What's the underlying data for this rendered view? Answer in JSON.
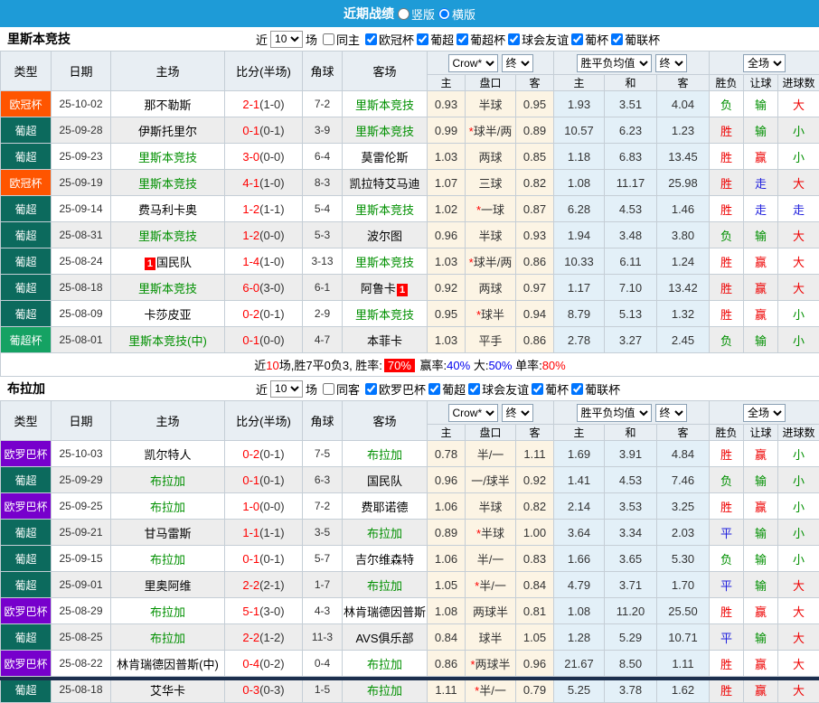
{
  "topbar": {
    "title": "近期战绩",
    "vertical": "竖版",
    "horizontal": "横版",
    "selected": "横版"
  },
  "header": {
    "cols": [
      "类型",
      "日期",
      "主场",
      "比分(半场)",
      "角球",
      "客场"
    ],
    "sub": [
      "主",
      "盘口",
      "客",
      "主",
      "和",
      "客",
      "胜负",
      "让球",
      "进球数"
    ],
    "odds_provider": "Crow*",
    "odds_state": "终",
    "avg_label": "胜平负均值",
    "avg_state": "终",
    "scope": "全场"
  },
  "colors": {
    "accent_blue": "#1e9bd7",
    "league_champions": "#ff5500",
    "league_liga_pt": "#0c6a5d",
    "league_supercup": "#15a263",
    "league_europa": "#7700cc",
    "win_red": "#ee0000",
    "lose_green": "#009000",
    "draw_blue": "#2020dd",
    "odds_bg": "#fcf4e4",
    "avg_bg": "#e3f0f8"
  },
  "tables": [
    {
      "team": "里斯本竞技",
      "filter": {
        "near_label": "近",
        "count": "10",
        "games_label": "场",
        "same_label": "同主",
        "same_checked": false,
        "leagues": [
          {
            "label": "欧冠杯",
            "checked": true
          },
          {
            "label": "葡超",
            "checked": true
          },
          {
            "label": "葡超杯",
            "checked": true
          },
          {
            "label": "球会友谊",
            "checked": true
          },
          {
            "label": "葡杯",
            "checked": true
          },
          {
            "label": "葡联杯",
            "checked": true
          }
        ]
      },
      "rows": [
        {
          "league": "欧冠杯",
          "league_color": "#ff5500",
          "date": "25-10-02",
          "home": "那不勒斯",
          "home_green": false,
          "score": "2-1",
          "half": "(1-0)",
          "corner": "7-2",
          "away": "里斯本竞技",
          "away_green": true,
          "odds": [
            "0.93",
            "半球",
            "0.95"
          ],
          "avg": [
            "1.93",
            "3.51",
            "4.04"
          ],
          "res": [
            [
              "负",
              "g"
            ],
            [
              "输",
              "g"
            ],
            [
              "大",
              "r"
            ]
          ]
        },
        {
          "league": "葡超",
          "league_color": "#0c6a5d",
          "date": "25-09-28",
          "home": "伊斯托里尔",
          "home_green": false,
          "score": "0-1",
          "half": "(0-1)",
          "corner": "3-9",
          "away": "里斯本竞技",
          "away_green": true,
          "odds": [
            "0.99",
            "*球半/两",
            "0.89"
          ],
          "avg": [
            "10.57",
            "6.23",
            "1.23"
          ],
          "res": [
            [
              "胜",
              "r"
            ],
            [
              "输",
              "g"
            ],
            [
              "小",
              "g"
            ]
          ]
        },
        {
          "league": "葡超",
          "league_color": "#0c6a5d",
          "date": "25-09-23",
          "home": "里斯本竞技",
          "home_green": true,
          "score": "3-0",
          "half": "(0-0)",
          "corner": "6-4",
          "away": "莫雷伦斯",
          "away_green": false,
          "odds": [
            "1.03",
            "两球",
            "0.85"
          ],
          "avg": [
            "1.18",
            "6.83",
            "13.45"
          ],
          "res": [
            [
              "胜",
              "r"
            ],
            [
              "赢",
              "r"
            ],
            [
              "小",
              "g"
            ]
          ]
        },
        {
          "league": "欧冠杯",
          "league_color": "#ff5500",
          "date": "25-09-19",
          "home": "里斯本竞技",
          "home_green": true,
          "score": "4-1",
          "half": "(1-0)",
          "corner": "8-3",
          "away": "凯拉特艾马迪",
          "away_green": false,
          "odds": [
            "1.07",
            "三球",
            "0.82"
          ],
          "avg": [
            "1.08",
            "11.17",
            "25.98"
          ],
          "res": [
            [
              "胜",
              "r"
            ],
            [
              "走",
              "b"
            ],
            [
              "大",
              "r"
            ]
          ]
        },
        {
          "league": "葡超",
          "league_color": "#0c6a5d",
          "date": "25-09-14",
          "home": "费马利卡奥",
          "home_green": false,
          "score": "1-2",
          "half": "(1-1)",
          "corner": "5-4",
          "away": "里斯本竞技",
          "away_green": true,
          "odds": [
            "1.02",
            "*一球",
            "0.87"
          ],
          "avg": [
            "6.28",
            "4.53",
            "1.46"
          ],
          "res": [
            [
              "胜",
              "r"
            ],
            [
              "走",
              "b"
            ],
            [
              "走",
              "b"
            ]
          ]
        },
        {
          "league": "葡超",
          "league_color": "#0c6a5d",
          "date": "25-08-31",
          "home": "里斯本竞技",
          "home_green": true,
          "score": "1-2",
          "half": "(0-0)",
          "corner": "5-3",
          "away": "波尔图",
          "away_green": false,
          "odds": [
            "0.96",
            "半球",
            "0.93"
          ],
          "avg": [
            "1.94",
            "3.48",
            "3.80"
          ],
          "res": [
            [
              "负",
              "g"
            ],
            [
              "输",
              "g"
            ],
            [
              "大",
              "r"
            ]
          ]
        },
        {
          "league": "葡超",
          "league_color": "#0c6a5d",
          "date": "25-08-24",
          "home": "国民队",
          "home_green": false,
          "home_rank": "1",
          "score": "1-4",
          "half": "(1-0)",
          "corner": "3-13",
          "away": "里斯本竞技",
          "away_green": true,
          "odds": [
            "1.03",
            "*球半/两",
            "0.86"
          ],
          "avg": [
            "10.33",
            "6.11",
            "1.24"
          ],
          "res": [
            [
              "胜",
              "r"
            ],
            [
              "赢",
              "r"
            ],
            [
              "大",
              "r"
            ]
          ]
        },
        {
          "league": "葡超",
          "league_color": "#0c6a5d",
          "date": "25-08-18",
          "home": "里斯本竞技",
          "home_green": true,
          "score": "6-0",
          "half": "(3-0)",
          "corner": "6-1",
          "away": "阿鲁卡",
          "away_green": false,
          "away_rank": "1",
          "odds": [
            "0.92",
            "两球",
            "0.97"
          ],
          "avg": [
            "1.17",
            "7.10",
            "13.42"
          ],
          "res": [
            [
              "胜",
              "r"
            ],
            [
              "赢",
              "r"
            ],
            [
              "大",
              "r"
            ]
          ]
        },
        {
          "league": "葡超",
          "league_color": "#0c6a5d",
          "date": "25-08-09",
          "home": "卡莎皮亚",
          "home_green": false,
          "score": "0-2",
          "half": "(0-1)",
          "corner": "2-9",
          "away": "里斯本竞技",
          "away_green": true,
          "odds": [
            "0.95",
            "*球半",
            "0.94"
          ],
          "avg": [
            "8.79",
            "5.13",
            "1.32"
          ],
          "res": [
            [
              "胜",
              "r"
            ],
            [
              "赢",
              "r"
            ],
            [
              "小",
              "g"
            ]
          ]
        },
        {
          "league": "葡超杯",
          "league_color": "#15a263",
          "date": "25-08-01",
          "home": "里斯本竞技(中)",
          "home_green": true,
          "score": "0-1",
          "half": "(0-0)",
          "corner": "4-7",
          "away": "本菲卡",
          "away_green": false,
          "odds": [
            "1.03",
            "平手",
            "0.86"
          ],
          "avg": [
            "2.78",
            "3.27",
            "2.45"
          ],
          "res": [
            [
              "负",
              "g"
            ],
            [
              "输",
              "g"
            ],
            [
              "小",
              "g"
            ]
          ]
        }
      ],
      "summary": [
        {
          "t": "近",
          "c": "k"
        },
        {
          "t": "10",
          "c": "r"
        },
        {
          "t": "场,胜7平0负3, 胜率:",
          "c": "k"
        },
        {
          "t": "70%",
          "c": "badge"
        },
        {
          "t": " 赢率:",
          "c": "k"
        },
        {
          "t": "40%",
          "c": "b"
        },
        {
          "t": " 大:",
          "c": "k"
        },
        {
          "t": "50%",
          "c": "b"
        },
        {
          "t": " 单率:",
          "c": "k"
        },
        {
          "t": "80%",
          "c": "r"
        }
      ]
    },
    {
      "team": "布拉加",
      "filter": {
        "near_label": "近",
        "count": "10",
        "games_label": "场",
        "same_label": "同客",
        "same_checked": false,
        "leagues": [
          {
            "label": "欧罗巴杯",
            "checked": true
          },
          {
            "label": "葡超",
            "checked": true
          },
          {
            "label": "球会友谊",
            "checked": true
          },
          {
            "label": "葡杯",
            "checked": true
          },
          {
            "label": "葡联杯",
            "checked": true
          }
        ]
      },
      "rows": [
        {
          "league": "欧罗巴杯",
          "league_color": "#7700cc",
          "date": "25-10-03",
          "home": "凯尔特人",
          "home_green": false,
          "score": "0-2",
          "half": "(0-1)",
          "corner": "7-5",
          "away": "布拉加",
          "away_green": true,
          "odds": [
            "0.78",
            "半/一",
            "1.11"
          ],
          "avg": [
            "1.69",
            "3.91",
            "4.84"
          ],
          "res": [
            [
              "胜",
              "r"
            ],
            [
              "赢",
              "r"
            ],
            [
              "小",
              "g"
            ]
          ]
        },
        {
          "league": "葡超",
          "league_color": "#0c6a5d",
          "date": "25-09-29",
          "home": "布拉加",
          "home_green": true,
          "score": "0-1",
          "half": "(0-1)",
          "corner": "6-3",
          "away": "国民队",
          "away_green": false,
          "odds": [
            "0.96",
            "一/球半",
            "0.92"
          ],
          "avg": [
            "1.41",
            "4.53",
            "7.46"
          ],
          "res": [
            [
              "负",
              "g"
            ],
            [
              "输",
              "g"
            ],
            [
              "小",
              "g"
            ]
          ]
        },
        {
          "league": "欧罗巴杯",
          "league_color": "#7700cc",
          "date": "25-09-25",
          "home": "布拉加",
          "home_green": true,
          "score": "1-0",
          "half": "(0-0)",
          "corner": "7-2",
          "away": "费耶诺德",
          "away_green": false,
          "odds": [
            "1.06",
            "半球",
            "0.82"
          ],
          "avg": [
            "2.14",
            "3.53",
            "3.25"
          ],
          "res": [
            [
              "胜",
              "r"
            ],
            [
              "赢",
              "r"
            ],
            [
              "小",
              "g"
            ]
          ]
        },
        {
          "league": "葡超",
          "league_color": "#0c6a5d",
          "date": "25-09-21",
          "home": "甘马雷斯",
          "home_green": false,
          "score": "1-1",
          "half": "(1-1)",
          "corner": "3-5",
          "away": "布拉加",
          "away_green": true,
          "odds": [
            "0.89",
            "*半球",
            "1.00"
          ],
          "avg": [
            "3.64",
            "3.34",
            "2.03"
          ],
          "res": [
            [
              "平",
              "b"
            ],
            [
              "输",
              "g"
            ],
            [
              "小",
              "g"
            ]
          ]
        },
        {
          "league": "葡超",
          "league_color": "#0c6a5d",
          "date": "25-09-15",
          "home": "布拉加",
          "home_green": true,
          "score": "0-1",
          "half": "(0-1)",
          "corner": "5-7",
          "away": "吉尔维森特",
          "away_green": false,
          "odds": [
            "1.06",
            "半/一",
            "0.83"
          ],
          "avg": [
            "1.66",
            "3.65",
            "5.30"
          ],
          "res": [
            [
              "负",
              "g"
            ],
            [
              "输",
              "g"
            ],
            [
              "小",
              "g"
            ]
          ]
        },
        {
          "league": "葡超",
          "league_color": "#0c6a5d",
          "date": "25-09-01",
          "home": "里奥阿维",
          "home_green": false,
          "score": "2-2",
          "half": "(2-1)",
          "corner": "1-7",
          "away": "布拉加",
          "away_green": true,
          "odds": [
            "1.05",
            "*半/一",
            "0.84"
          ],
          "avg": [
            "4.79",
            "3.71",
            "1.70"
          ],
          "res": [
            [
              "平",
              "b"
            ],
            [
              "输",
              "g"
            ],
            [
              "大",
              "r"
            ]
          ]
        },
        {
          "league": "欧罗巴杯",
          "league_color": "#7700cc",
          "date": "25-08-29",
          "home": "布拉加",
          "home_green": true,
          "score": "5-1",
          "half": "(3-0)",
          "corner": "4-3",
          "away": "林肯瑞德因普斯",
          "away_green": false,
          "odds": [
            "1.08",
            "两球半",
            "0.81"
          ],
          "avg": [
            "1.08",
            "11.20",
            "25.50"
          ],
          "res": [
            [
              "胜",
              "r"
            ],
            [
              "赢",
              "r"
            ],
            [
              "大",
              "r"
            ]
          ]
        },
        {
          "league": "葡超",
          "league_color": "#0c6a5d",
          "date": "25-08-25",
          "home": "布拉加",
          "home_green": true,
          "score": "2-2",
          "half": "(1-2)",
          "corner": "11-3",
          "away": "AVS俱乐部",
          "away_green": false,
          "odds": [
            "0.84",
            "球半",
            "1.05"
          ],
          "avg": [
            "1.28",
            "5.29",
            "10.71"
          ],
          "res": [
            [
              "平",
              "b"
            ],
            [
              "输",
              "g"
            ],
            [
              "大",
              "r"
            ]
          ]
        },
        {
          "league": "欧罗巴杯",
          "league_color": "#7700cc",
          "date": "25-08-22",
          "home": "林肯瑞德因普斯(中)",
          "home_green": false,
          "score": "0-4",
          "half": "(0-2)",
          "corner": "0-4",
          "away": "布拉加",
          "away_green": true,
          "odds": [
            "0.86",
            "*两球半",
            "0.96"
          ],
          "avg": [
            "21.67",
            "8.50",
            "1.11"
          ],
          "res": [
            [
              "胜",
              "r"
            ],
            [
              "赢",
              "r"
            ],
            [
              "大",
              "r"
            ]
          ]
        },
        {
          "league": "葡超",
          "league_color": "#0c6a5d",
          "date": "25-08-18",
          "home": "艾华卡",
          "home_green": false,
          "score": "0-3",
          "half": "(0-3)",
          "corner": "1-5",
          "away": "布拉加",
          "away_green": true,
          "odds": [
            "1.11",
            "*半/一",
            "0.79"
          ],
          "avg": [
            "5.25",
            "3.78",
            "1.62"
          ],
          "res": [
            [
              "胜",
              "r"
            ],
            [
              "赢",
              "r"
            ],
            [
              "大",
              "r"
            ]
          ]
        }
      ],
      "summary": null
    }
  ]
}
